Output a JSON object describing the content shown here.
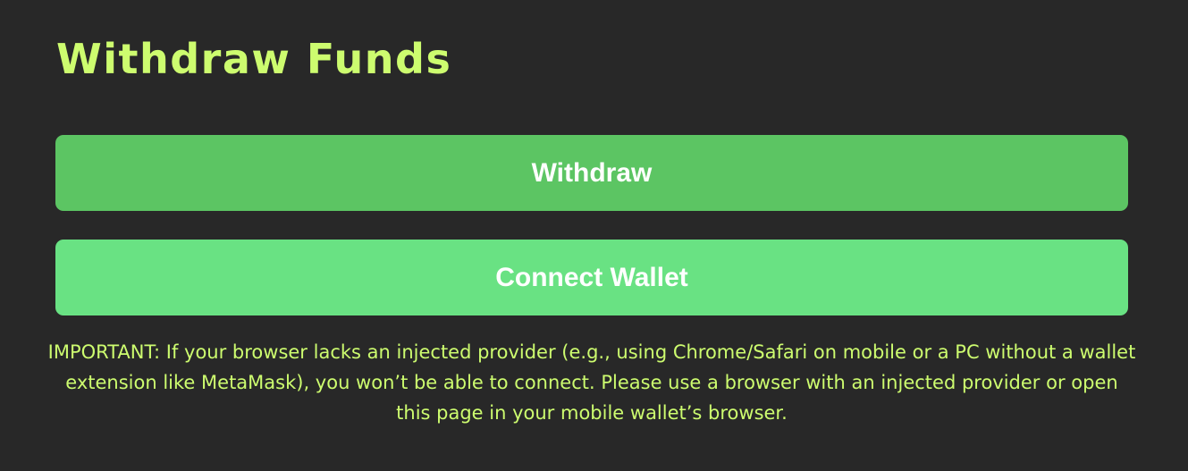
{
  "page": {
    "title": "Withdraw Funds"
  },
  "actions": {
    "withdraw_label": "Withdraw",
    "connect_wallet_label": "Connect Wallet"
  },
  "notice": {
    "text": "IMPORTANT: If your browser lacks an injected provider (e.g., using Chrome/Safari on mobile or a PC without a wallet extension like MetaMask), you won’t be able to connect. Please use a browser with an injected provider or open this page in your mobile wallet’s browser."
  },
  "colors": {
    "background": "#282828",
    "accent_text": "#cdfc6f",
    "withdraw_button": "#5cc563",
    "connect_button": "#69e283"
  }
}
